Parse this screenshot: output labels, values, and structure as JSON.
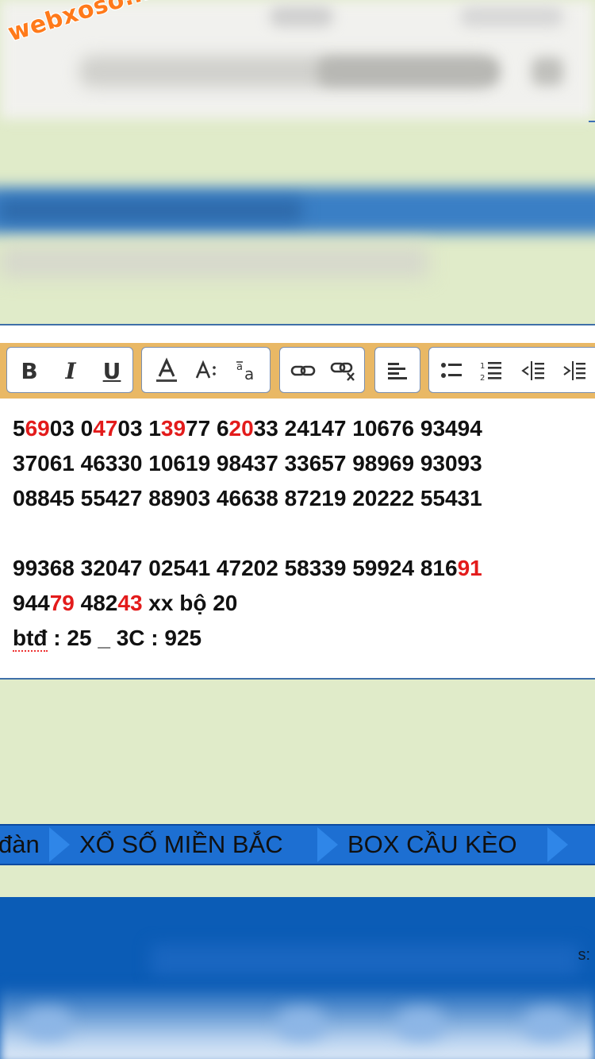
{
  "watermark": "webxoso.net",
  "toolbar": {
    "bold": "B",
    "italic": "I",
    "underline": "U"
  },
  "editor": {
    "lines": [
      [
        {
          "t": "5"
        },
        {
          "t": "69",
          "red": true
        },
        {
          "t": "03 0"
        },
        {
          "t": "47",
          "red": true
        },
        {
          "t": "03 1"
        },
        {
          "t": "39",
          "red": true
        },
        {
          "t": "77 6"
        },
        {
          "t": "20",
          "red": true
        },
        {
          "t": "33 24147 10676 93494"
        }
      ],
      [
        {
          "t": "37061 46330 10619 98437 33657 98969 93093"
        }
      ],
      [
        {
          "t": "08845 55427 88903 46638 87219 20222 55431"
        }
      ],
      [
        {
          "t": " "
        }
      ],
      [
        {
          "t": "99368 32047 02541 47202 58339 59924 816"
        },
        {
          "t": "91",
          "red": true
        }
      ],
      [
        {
          "t": "944"
        },
        {
          "t": "79",
          "red": true
        },
        {
          "t": " 482"
        },
        {
          "t": "43",
          "red": true
        },
        {
          "t": " xx bộ 20"
        }
      ],
      [
        {
          "t": "btđ",
          "squiggle": true
        },
        {
          "t": " : 25 _ 3C : 925"
        }
      ]
    ]
  },
  "nav": {
    "items": [
      "đàn",
      "XỔ SỐ MIỀN BẮC",
      "BOX CẦU KÈO"
    ]
  },
  "bottom": {
    "label_fragment": "s:"
  },
  "colors": {
    "accent_red": "#e31b1b",
    "nav_blue": "#1d6fd2",
    "toolbar_orange": "#e9b865",
    "page_green": "#e0ebc9"
  }
}
